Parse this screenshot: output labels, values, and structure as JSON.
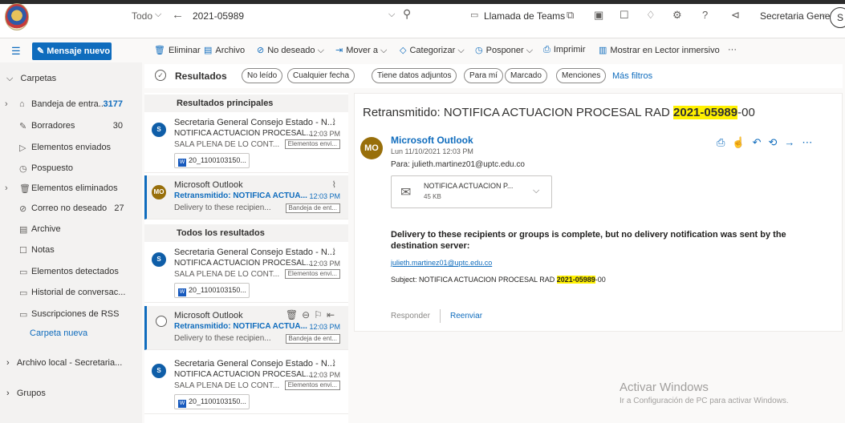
{
  "topbar": {
    "scope": "Todo",
    "search_query": "2021-05989",
    "teams_label": "Llamada de Teams",
    "account_name": "Secretaria General...",
    "avatar_initial": "S"
  },
  "commands": {
    "new_message": "Mensaje nuevo",
    "delete": "Eliminar",
    "archive": "Archivo",
    "junk": "No deseado",
    "move": "Mover a",
    "categorize": "Categorizar",
    "snooze": "Posponer",
    "print": "Imprimir",
    "immersive": "Mostrar en Lector inmersivo",
    "more": "···"
  },
  "folders": {
    "header": "Carpetas",
    "items": [
      {
        "label": "Bandeja de entra...",
        "count": "3177",
        "icon": "inbox-icon"
      },
      {
        "label": "Borradores",
        "count": "30",
        "icon": "pencil-icon"
      },
      {
        "label": "Elementos enviados",
        "count": "",
        "icon": "send-icon"
      },
      {
        "label": "Pospuesto",
        "count": "",
        "icon": "clock-icon"
      },
      {
        "label": "Elementos eliminados",
        "count": "",
        "icon": "trash-icon"
      },
      {
        "label": "Correo no deseado",
        "count": "27",
        "icon": "block-icon"
      },
      {
        "label": "Archive",
        "count": "",
        "icon": "archive-icon"
      },
      {
        "label": "Notas",
        "count": "",
        "icon": "note-icon"
      },
      {
        "label": "Elementos detectados",
        "count": "",
        "icon": "folder-icon"
      },
      {
        "label": "Historial de conversac...",
        "count": "",
        "icon": "folder-icon"
      },
      {
        "label": "Suscripciones de RSS",
        "count": "",
        "icon": "folder-icon"
      }
    ],
    "new_folder": "Carpeta nueva",
    "local_archive": "Archivo local - Secretaria...",
    "groups": "Grupos"
  },
  "filters": {
    "title": "Resultados",
    "pills": [
      "No leído",
      "Cualquier fecha",
      "Tiene datos adjuntos",
      "Para mí",
      "Marcado",
      "Menciones"
    ],
    "more": "Más filtros"
  },
  "list": {
    "top_results_header": "Resultados principales",
    "all_results_header": "Todos los resultados",
    "messages": [
      {
        "avatar": "S",
        "sender": "Secretaria General Consejo Estado - N...",
        "subject": "NOTIFICA ACTUACION PROCESAL...",
        "time": "12:03 PM",
        "preview": "SALA PLENA DE LO CONT...",
        "tag": "Elementos envi...",
        "attachment": "20_1100103150..."
      },
      {
        "avatar": "MO",
        "sender": "Microsoft Outlook",
        "subject": "Retransmitido: NOTIFICA ACTUA...",
        "time": "12:03 PM",
        "preview": "Delivery to these recipien...",
        "tag": "Bandeja de ent..."
      },
      {
        "avatar": "S",
        "sender": "Secretaria General Consejo Estado - N...",
        "subject": "NOTIFICA ACTUACION PROCESAL...",
        "time": "12:03 PM",
        "preview": "SALA PLENA DE LO CONT...",
        "tag": "Elementos envi...",
        "attachment": "20_1100103150..."
      },
      {
        "avatar": "",
        "sender": "Microsoft Outlook",
        "subject": "Retransmitido: NOTIFICA ACTUA...",
        "time": "12:03 PM",
        "preview": "Delivery to these recipien...",
        "tag": "Bandeja de ent..."
      },
      {
        "avatar": "S",
        "sender": "Secretaria General Consejo Estado - N...",
        "subject": "NOTIFICA ACTUACION PROCESAL...",
        "time": "12:03 PM",
        "preview": "SALA PLENA DE LO CONT...",
        "tag": "Elementos envi...",
        "attachment": "20_1100103150..."
      }
    ]
  },
  "reading": {
    "title_prefix": "Retransmitido: NOTIFICA ACTUACION PROCESAL RAD ",
    "title_highlight": "2021-05989",
    "title_suffix": "-00",
    "avatar": "MO",
    "sender": "Microsoft Outlook",
    "date": "Lun 11/10/2021 12:03 PM",
    "to": "Para:  julieth.martinez01@uptc.edu.co",
    "attachment_name": "NOTIFICA ACTUACION P...",
    "attachment_size": "45 KB",
    "body_bold": "Delivery to these recipients or groups is complete, but no delivery notification was sent by the destination server:",
    "recipient_link": "julieth.martinez01@uptc.edu.co",
    "subject_prefix": "Subject: NOTIFICA ACTUACION PROCESAL RAD ",
    "subject_highlight": "2021-05989",
    "subject_suffix": "-00",
    "reply": "Responder",
    "forward": "Reenviar"
  },
  "watermark": {
    "line1": "Activar Windows",
    "line2": "Ir a Configuración de PC para activar Windows."
  },
  "colors": {
    "accent": "#0f6cbd",
    "highlight": "#fff100",
    "mo_avatar": "#986f0b",
    "s_avatar": "#0f5ea8"
  }
}
